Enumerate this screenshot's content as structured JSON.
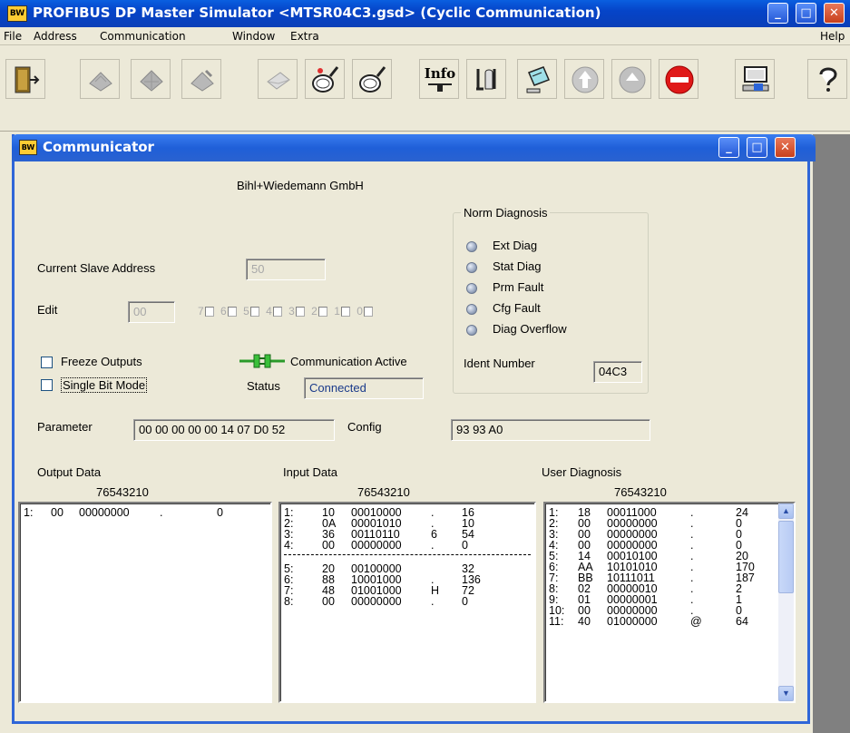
{
  "app": {
    "title": "PROFIBUS DP Master Simulator <MTSR04C3.gsd> (Cyclic Communication)",
    "icon_text": "BW"
  },
  "menu": {
    "file": "File",
    "address": "Address",
    "communication": "Communication",
    "window": "Window",
    "extra": "Extra",
    "help": "Help"
  },
  "toolbar": {
    "info_label": "Info",
    "buttons": [
      "exit-icon",
      "module-icon",
      "module-grid-icon",
      "module-edit-icon",
      "envelope-icon",
      "magnifier-star-icon",
      "magnifier-icon",
      "info-icon",
      "tools-icon",
      "handheld-icon",
      "arrow-up-icon",
      "arrow-up-gray-icon",
      "stop-icon",
      "network-computer-icon",
      "question-icon"
    ]
  },
  "communicator": {
    "title": "Communicator",
    "vendor": "Bihl+Wiedemann GmbH",
    "current_slave_address_label": "Current Slave Address",
    "current_slave_address_value": "50",
    "edit_label": "Edit",
    "edit_value": "00",
    "bits": [
      "7",
      "6",
      "5",
      "4",
      "3",
      "2",
      "1",
      "0"
    ],
    "freeze_outputs_label": "Freeze Outputs",
    "single_bit_mode_label": "Single Bit Mode",
    "comm_active_label": "Communication Active",
    "status_label": "Status",
    "status_value": "Connected",
    "norm_diag": {
      "title": "Norm Diagnosis",
      "items": [
        "Ext Diag",
        "Stat Diag",
        "Prm Fault",
        "Cfg Fault",
        "Diag Overflow"
      ],
      "ident_label": "Ident Number",
      "ident_value": "04C3"
    },
    "parameter_label": "Parameter",
    "parameter_value": "00 00 00 00 00 14 07 D0 52",
    "config_label": "Config",
    "config_value": "93 93 A0",
    "output": {
      "label": "Output Data",
      "bit_header": "76543210",
      "rows": [
        {
          "idx": "1:",
          "hex": "00",
          "bin": "00000000",
          "ch": ".",
          "dec": "0"
        }
      ]
    },
    "input": {
      "label": "Input Data",
      "bit_header": "76543210",
      "rows": [
        {
          "idx": "1:",
          "hex": "10",
          "bin": "00010000",
          "ch": ".",
          "dec": "16"
        },
        {
          "idx": "2:",
          "hex": "0A",
          "bin": "00001010",
          "ch": ".",
          "dec": "10"
        },
        {
          "idx": "3:",
          "hex": "36",
          "bin": "00110110",
          "ch": "6",
          "dec": "54"
        },
        {
          "idx": "4:",
          "hex": "00",
          "bin": "00000000",
          "ch": ".",
          "dec": "0"
        },
        {
          "idx": "5:",
          "hex": "20",
          "bin": "00100000",
          "ch": "",
          "dec": "32"
        },
        {
          "idx": "6:",
          "hex": "88",
          "bin": "10001000",
          "ch": ".",
          "dec": "136"
        },
        {
          "idx": "7:",
          "hex": "48",
          "bin": "01001000",
          "ch": "H",
          "dec": "72"
        },
        {
          "idx": "8:",
          "hex": "00",
          "bin": "00000000",
          "ch": ".",
          "dec": "0"
        }
      ]
    },
    "user_diag": {
      "label": "User Diagnosis",
      "bit_header": "76543210",
      "rows": [
        {
          "idx": "1:",
          "hex": "18",
          "bin": "00011000",
          "ch": ".",
          "dec": "24"
        },
        {
          "idx": "2:",
          "hex": "00",
          "bin": "00000000",
          "ch": ".",
          "dec": "0"
        },
        {
          "idx": "3:",
          "hex": "00",
          "bin": "00000000",
          "ch": ".",
          "dec": "0"
        },
        {
          "idx": "4:",
          "hex": "00",
          "bin": "00000000",
          "ch": ".",
          "dec": "0"
        },
        {
          "idx": "5:",
          "hex": "14",
          "bin": "00010100",
          "ch": ".",
          "dec": "20"
        },
        {
          "idx": "6:",
          "hex": "AA",
          "bin": "10101010",
          "ch": ".",
          "dec": "170"
        },
        {
          "idx": "7:",
          "hex": "BB",
          "bin": "10111011",
          "ch": ".",
          "dec": "187"
        },
        {
          "idx": "8:",
          "hex": "02",
          "bin": "00000010",
          "ch": ".",
          "dec": "2"
        },
        {
          "idx": "9:",
          "hex": "01",
          "bin": "00000001",
          "ch": ".",
          "dec": "1"
        },
        {
          "idx": "10:",
          "hex": "00",
          "bin": "00000000",
          "ch": ".",
          "dec": "0"
        },
        {
          "idx": "11:",
          "hex": "40",
          "bin": "01000000",
          "ch": "@",
          "dec": "64"
        }
      ]
    }
  },
  "colors": {
    "title_blue": "#0544c8",
    "window_face": "#ece9d8",
    "close_red": "#c8401c"
  }
}
